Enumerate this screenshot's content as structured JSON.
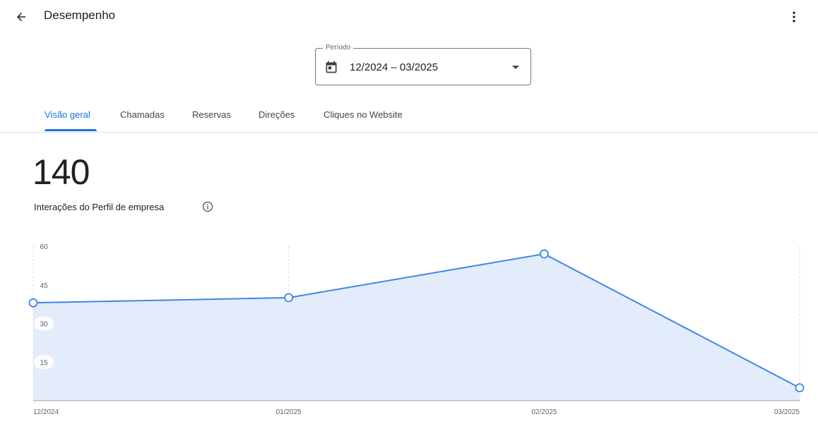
{
  "header": {
    "title": "Desempenho",
    "back_icon": "arrow-left-icon",
    "menu_icon": "more-vert-icon"
  },
  "period": {
    "label": "Período",
    "value": "12/2024 – 03/2025",
    "icon": "calendar-icon"
  },
  "tabs": [
    {
      "label": "Visão geral",
      "active": true
    },
    {
      "label": "Chamadas",
      "active": false
    },
    {
      "label": "Reservas",
      "active": false
    },
    {
      "label": "Direções",
      "active": false
    },
    {
      "label": "Cliques no Website",
      "active": false
    }
  ],
  "summary": {
    "total": "140",
    "label": "Interações do Perfil de empresa",
    "info_icon": "info-icon"
  },
  "colors": {
    "accent": "#1a73e8",
    "line": "#3f86e8",
    "area": "#e2ecfb"
  },
  "chart_data": {
    "type": "area",
    "categories": [
      "12/2024",
      "01/2025",
      "02/2025",
      "03/2025"
    ],
    "series": [
      {
        "values": [
          38,
          40,
          57,
          5
        ]
      }
    ],
    "ylim": [
      0,
      60
    ],
    "yticks": [
      15,
      30,
      45,
      60
    ],
    "grid": "vertical-dashed",
    "legend": "none"
  }
}
